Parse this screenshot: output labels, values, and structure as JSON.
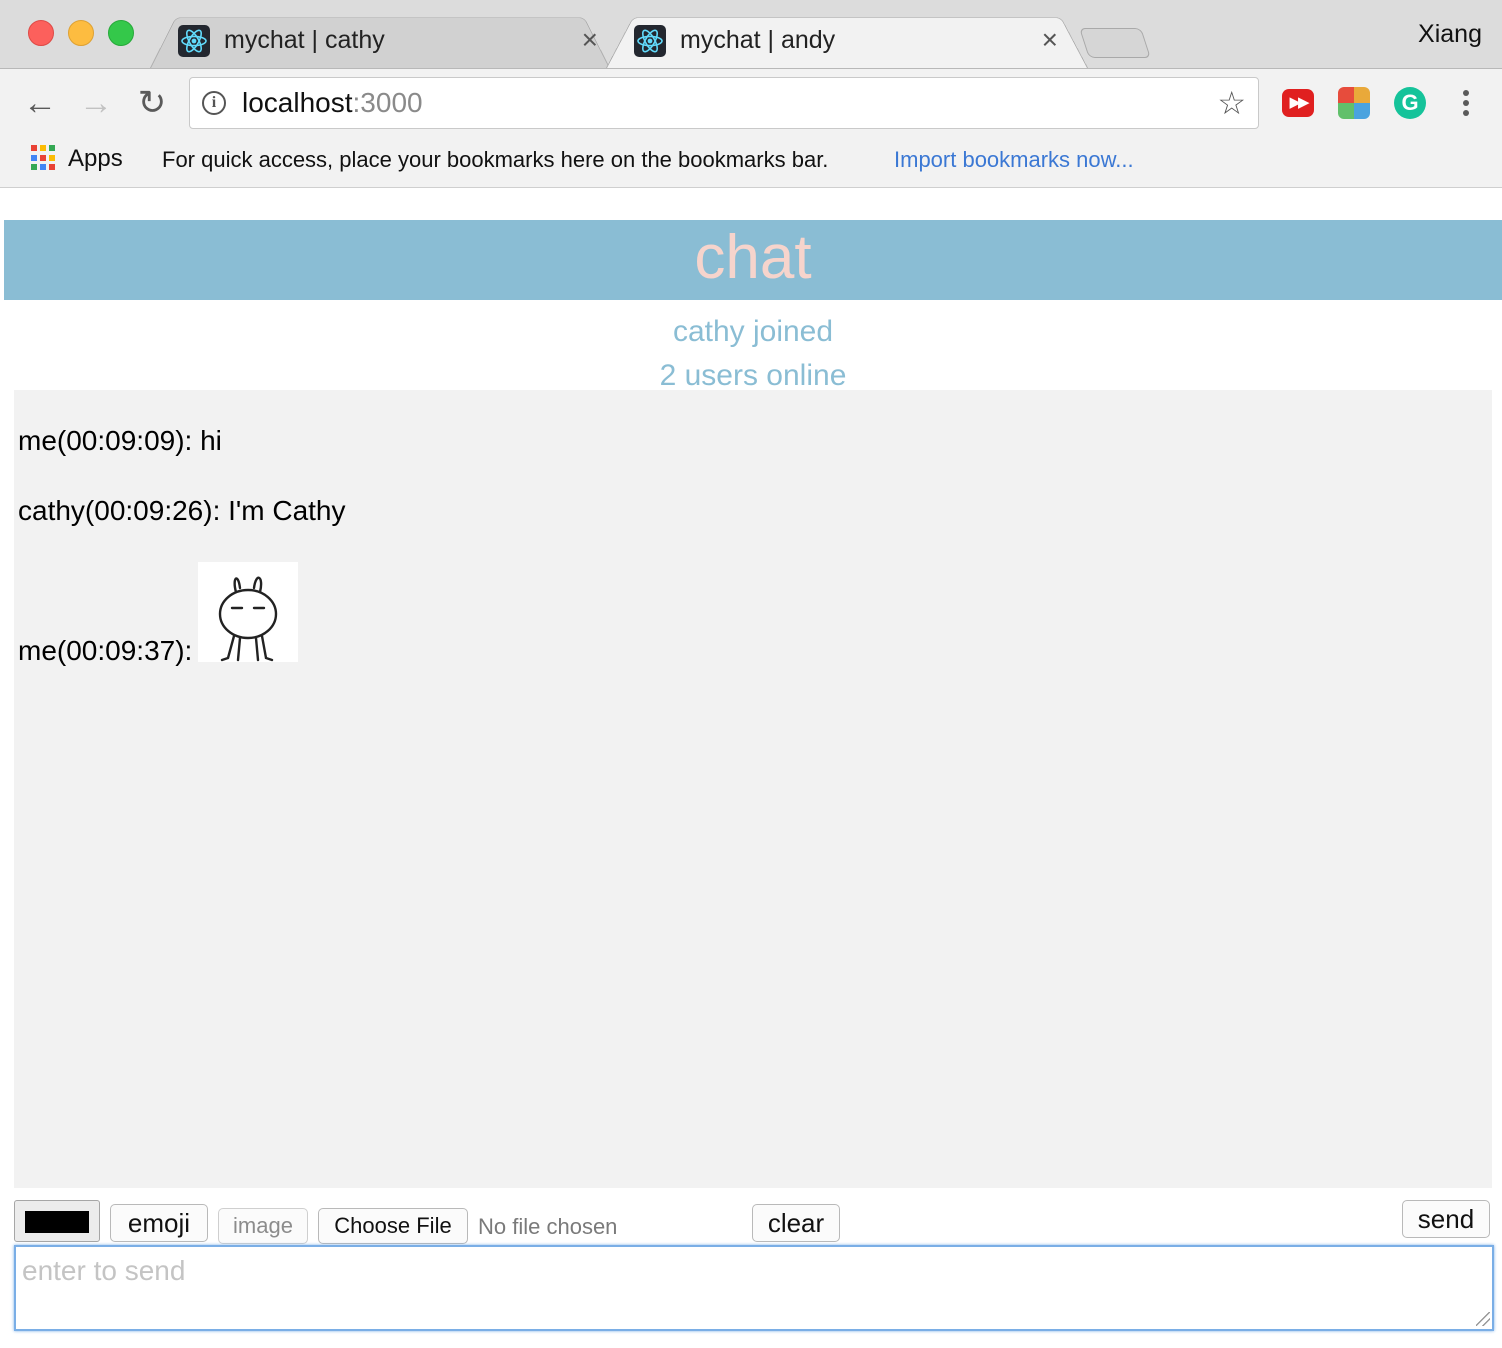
{
  "browser": {
    "tabs": [
      {
        "title": "mychat | cathy",
        "active": false
      },
      {
        "title": "mychat | andy",
        "active": true
      }
    ],
    "close_symbol": "×",
    "profile_name": "Xiang",
    "nav": {
      "back_icon": "back-arrow-icon",
      "forward_icon": "forward-arrow-icon",
      "reload_icon": "reload-icon",
      "back": "←",
      "forward": "→",
      "reload": "↻"
    },
    "address": {
      "host": "localhost",
      "port": ":3000",
      "star": "☆",
      "info": "i"
    },
    "extensions": [
      "youtube-icon",
      "shield-extension-icon",
      "grammarly-icon"
    ],
    "extension_glyphs": {
      "youtube": "▶▶",
      "grammarly": "G"
    },
    "bookmarks_bar": {
      "apps_label": "Apps",
      "hint": "For quick access, place your bookmarks here on the bookmarks bar.",
      "import_link": "Import bookmarks now..."
    },
    "colors": {
      "apps_grid": [
        "#e94235",
        "#fbbc05",
        "#34a853",
        "#4285f4",
        "#e94235",
        "#fbbc05",
        "#34a853",
        "#4285f4",
        "#e94235"
      ]
    }
  },
  "app": {
    "title": "chat",
    "notices": {
      "joined": "cathy joined",
      "online": "2 users online"
    },
    "messages": [
      {
        "sender_time": "me(00:09:09): ",
        "text": "hi"
      },
      {
        "sender_time": "cathy(00:09:26): ",
        "text": "I'm Cathy"
      },
      {
        "sender_time": "me(00:09:37): ",
        "text": "",
        "image": "bunny-sticker"
      }
    ],
    "controls": {
      "color_value": "#000000",
      "emoji_label": "emoji",
      "image_label": "image",
      "choose_file_label": "Choose File",
      "no_file_label": "No file chosen",
      "clear_label": "clear",
      "send_label": "send"
    },
    "input": {
      "placeholder": "enter to send",
      "value": ""
    },
    "colors": {
      "banner_bg": "#8abdd4",
      "banner_text": "#f6d4cc",
      "notice_text": "#8abdd4",
      "messages_bg": "#f2f2f2",
      "focus_ring": "#7aaee6"
    }
  }
}
